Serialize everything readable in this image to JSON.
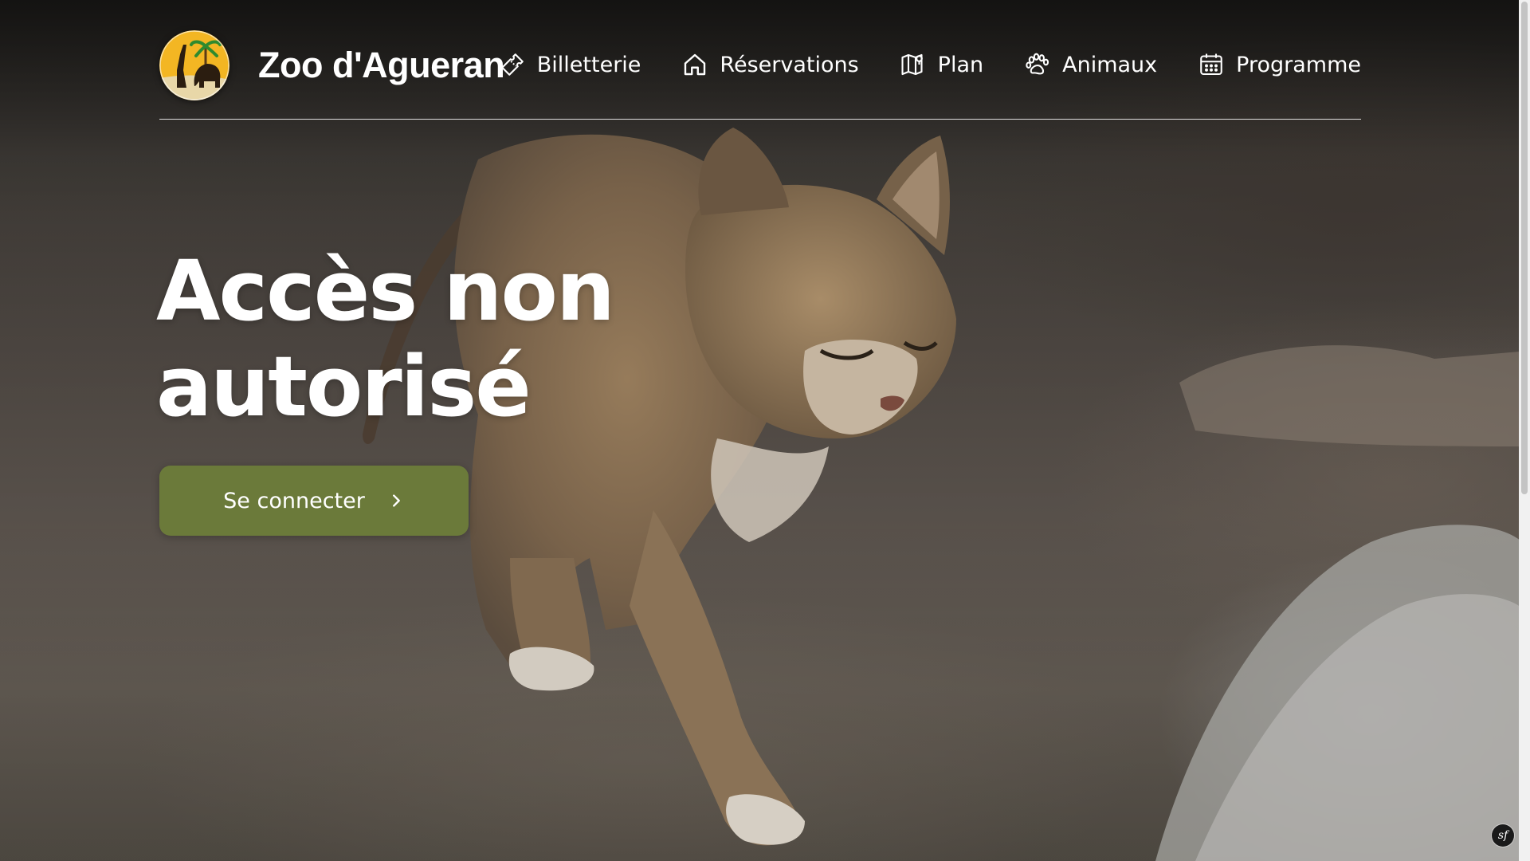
{
  "site": {
    "name": "Zoo d'Agueran",
    "logo_icon": "zoo-logo-giraffe-elephant"
  },
  "nav": {
    "items": [
      {
        "label": "Billetterie",
        "icon": "ticket-icon"
      },
      {
        "label": "Réservations",
        "icon": "home-icon"
      },
      {
        "label": "Plan",
        "icon": "map-icon"
      },
      {
        "label": "Animaux",
        "icon": "paw-icon"
      },
      {
        "label": "Programme",
        "icon": "calendar-icon"
      }
    ]
  },
  "hero": {
    "title_line1": "Accès non",
    "title_line2": "autorisé",
    "cta_label": "Se connecter",
    "cta_icon": "chevron-right-icon",
    "background_subject": "sand cat walking on sandy ground"
  },
  "colors": {
    "cta_background": "#6b7a3a",
    "text": "#ffffff",
    "divider": "#ffffff"
  },
  "debug": {
    "badge_label": "sf"
  }
}
